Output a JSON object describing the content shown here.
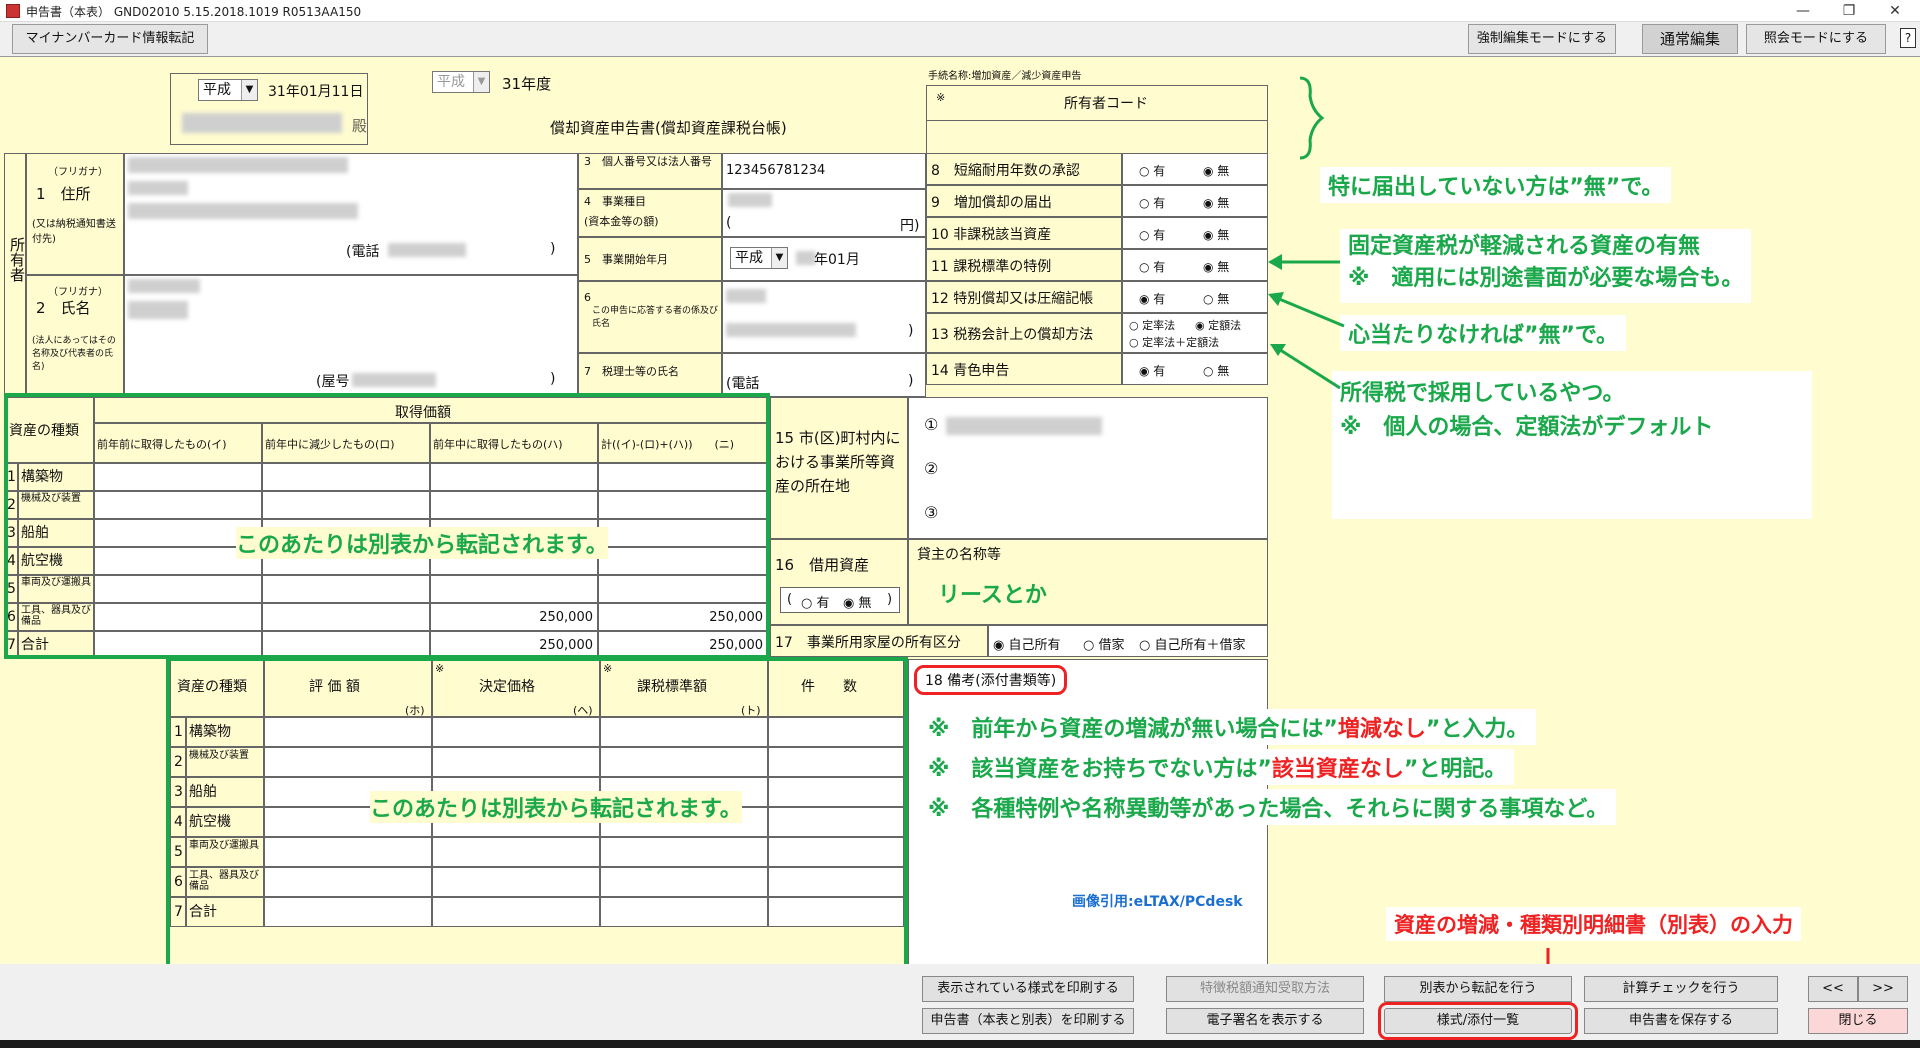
{
  "window": {
    "title": "申告書（本表） GND02010 5.15.2018.1019 R0513AA150",
    "minimize": "—",
    "restore": "❐",
    "close": "✕"
  },
  "toolbar": {
    "mynumber": "マイナンバーカード情報転記",
    "force_edit": "強制編集モードにする",
    "normal_edit": "通常編集",
    "inquiry": "照会モードにする",
    "help": "?"
  },
  "header": {
    "era": "平成",
    "date": "31年01月11日",
    "fy_era": "平成",
    "fy": "31年度",
    "addressee_suffix": "殿",
    "form_title": "償却資産申告書(償却資産課税台帳)",
    "procedure": "手続名称:増加資産／減少資産申告",
    "owner_code_mark": "※",
    "owner_code": "所有者コード"
  },
  "owner": {
    "side_label": "所有者",
    "furigana": "（フリガナ）",
    "address_label": "1　住所",
    "address_note": "(又は納税通知書送付先)",
    "phone": "(電話",
    "close_paren": ")",
    "name_label": "2　氏名",
    "name_note": "(法人にあってはその名称及び代表者の氏名)",
    "shop_name": "(屋号"
  },
  "middle": {
    "item3": "3　個人番号又は法人番号",
    "item3_value": "123456781234",
    "item4": "4　事業種目",
    "item4_sub": "(資本金等の額)",
    "yen": "円)",
    "open_paren": "(",
    "item5": "5　事業開始年月",
    "item5_era": "平成",
    "item5_month": "年01月",
    "item6": "6",
    "item6_note": "この申告に応答する者の係及び氏名",
    "item7": "7　税理士等の氏名",
    "phone": "(電話"
  },
  "right_items": [
    {
      "label": "8　短縮耐用年数の承認",
      "yes": "有",
      "no": "無",
      "selected": "no"
    },
    {
      "label": "9　増加償却の届出",
      "yes": "有",
      "no": "無",
      "selected": "no"
    },
    {
      "label": "10 非課税該当資産",
      "yes": "有",
      "no": "無",
      "selected": "no"
    },
    {
      "label": "11 課税標準の特例",
      "yes": "有",
      "no": "無",
      "selected": "no"
    },
    {
      "label": "12 特別償却又は圧縮記帳",
      "yes": "有",
      "no": "無",
      "selected": "yes"
    },
    {
      "label": "13 税務会計上の償却方法",
      "opt1": "定率法",
      "opt2": "定額法",
      "opt3": "定率法＋定額法",
      "selected": "opt2"
    },
    {
      "label": "14 青色申告",
      "yes": "有",
      "no": "無",
      "selected": "yes"
    }
  ],
  "acq_table": {
    "kind_header": "資産の種類",
    "group_header": "取得価額",
    "col_i": "前年前に取得したもの(イ)",
    "col_ro": "前年中に減少したもの(ロ)",
    "col_ha": "前年中に取得したもの(ハ)",
    "col_ni": "計((イ)-(ロ)+(ハ))　　(ニ)",
    "rows": [
      {
        "no": "1",
        "name": "構築物",
        "ha": "",
        "ni": ""
      },
      {
        "no": "2",
        "name": "機械及び装置",
        "ha": "",
        "ni": ""
      },
      {
        "no": "3",
        "name": "船舶",
        "ha": "",
        "ni": ""
      },
      {
        "no": "4",
        "name": "航空機",
        "ha": "",
        "ni": ""
      },
      {
        "no": "5",
        "name": "車両及び運搬具",
        "ha": "",
        "ni": ""
      },
      {
        "no": "6",
        "name": "工具、器具及び備品",
        "ha": "250,000",
        "ni": "250,000"
      },
      {
        "no": "7",
        "name": "合計",
        "ha": "250,000",
        "ni": "250,000"
      }
    ]
  },
  "eval_table": {
    "kind_header": "資産の種類",
    "col_ho": "評 価 額",
    "col_ho_mark": "(ホ)",
    "col_he": "決定価格",
    "col_he_mark": "(ヘ)",
    "col_to": "課税標準額",
    "col_to_mark": "(ト)",
    "col_count": "件　　数",
    "asterisk": "※",
    "rows": [
      {
        "no": "1",
        "name": "構築物"
      },
      {
        "no": "2",
        "name": "機械及び装置"
      },
      {
        "no": "3",
        "name": "船舶"
      },
      {
        "no": "4",
        "name": "航空機"
      },
      {
        "no": "5",
        "name": "車両及び運搬具"
      },
      {
        "no": "6",
        "name": "工具、器具及び備品"
      },
      {
        "no": "7",
        "name": "合計"
      }
    ]
  },
  "location": {
    "label": "15 市(区)町村内における事業所等資産の所在地",
    "c1": "①",
    "c2": "②",
    "c3": "③"
  },
  "lease": {
    "label": "16　借用資産",
    "yes": "有",
    "no": "無",
    "open": "(",
    "close": ")",
    "lessor": "貸主の名称等"
  },
  "ownership": {
    "label": "17　事業所用家屋の所有区分",
    "opt1": "自己所有",
    "opt2": "借家",
    "opt3": "自己所有＋借家"
  },
  "remarks": {
    "label": "18 備考(添付書類等)"
  },
  "annotations": {
    "a1": "特に届出していない方は”無”で。",
    "a2_l1": "固定資産税が軽減される資産の有無",
    "a2_l2": "※　適用には別途書面が必要な場合も。",
    "a3": "心当たりなければ”無”で。",
    "a4_l1": "所得税で採用しているやつ。",
    "a4_l2": "※　個人の場合、定額法がデフォルト",
    "transfer1": "このあたりは別表から転記されます。",
    "transfer2": "このあたりは別表から転記されます。",
    "lease_note": "リースとか",
    "r1_pre": "※　前年から資産の増減が無い場合には”",
    "r1_red": "増減なし",
    "r1_post": "”と入力。",
    "r2_pre": "※　該当資産をお持ちでない方は”",
    "r2_red": "該当資産なし",
    "r2_post": "”と明記。",
    "r3": "※　各種特例や名称異動等があった場合、それらに関する事項など。",
    "credit": "画像引用:eLTAX/PCdesk",
    "bottom_note": "資産の増減・種類別明細書（別表）の入力"
  },
  "buttons": {
    "print_shown": "表示されている様式を印刷する",
    "special_tax": "特徴税額通知受取方法",
    "transfer": "別表から転記を行う",
    "calc_check": "計算チェックを行う",
    "prev": "<<",
    "next": ">>",
    "print_all": "申告書（本表と別表）を印刷する",
    "signature": "電子署名を表示する",
    "attachments": "様式/添付一覧",
    "save": "申告書を保存する",
    "close": "閉じる"
  },
  "colors": {
    "accent_green": "#1aa84b",
    "red": "#e22222",
    "form_bg": "#fffcd0",
    "link_blue": "#1a6fd0"
  }
}
